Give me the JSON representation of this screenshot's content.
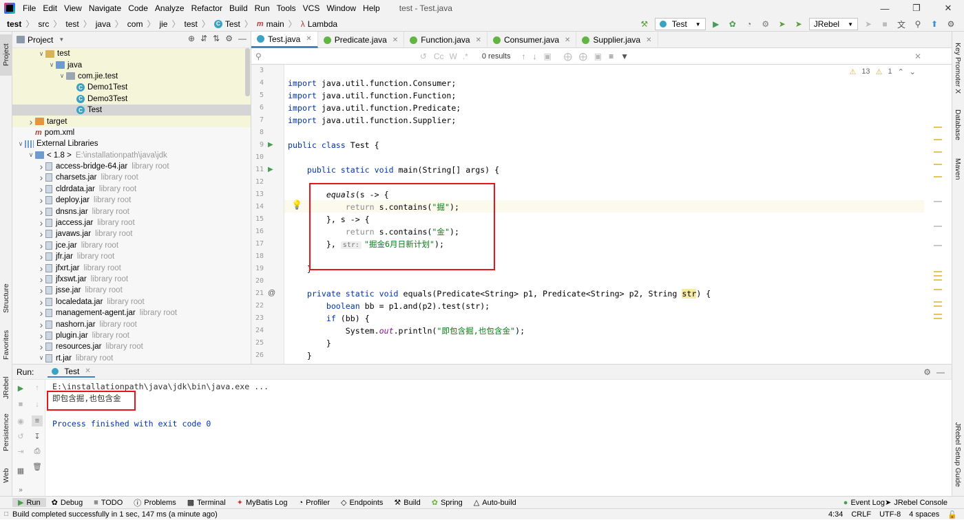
{
  "menubar": {
    "items": [
      "File",
      "Edit",
      "View",
      "Navigate",
      "Code",
      "Analyze",
      "Refactor",
      "Build",
      "Run",
      "Tools",
      "VCS",
      "Window",
      "Help"
    ],
    "window_title": "test - Test.java"
  },
  "breadcrumb": {
    "items": [
      "test",
      "src",
      "test",
      "java",
      "com",
      "jie",
      "test",
      "Test",
      "main",
      "Lambda"
    ]
  },
  "toolbar": {
    "run_config": "Test",
    "jrebel": "JRebel"
  },
  "project": {
    "title": "Project",
    "tree": [
      {
        "label": "test",
        "depth": 2,
        "type": "folder",
        "arrow": "open"
      },
      {
        "label": "java",
        "depth": 3,
        "type": "folder-blue",
        "arrow": "open"
      },
      {
        "label": "com.jie.test",
        "depth": 4,
        "type": "package",
        "arrow": "open"
      },
      {
        "label": "Demo1Test",
        "depth": 5,
        "type": "class"
      },
      {
        "label": "Demo3Test",
        "depth": 5,
        "type": "class"
      },
      {
        "label": "Test",
        "depth": 5,
        "type": "class",
        "selected": true
      },
      {
        "label": "target",
        "depth": 1,
        "type": "folder-orange",
        "arrow": "closed"
      },
      {
        "label": "pom.xml",
        "depth": 1,
        "type": "maven"
      },
      {
        "label": "External Libraries",
        "depth": 0,
        "type": "lib",
        "arrow": "open"
      },
      {
        "label": "< 1.8 >",
        "dim": "E:\\installationpath\\java\\jdk",
        "depth": 1,
        "type": "folder-blue",
        "arrow": "open"
      },
      {
        "label": "access-bridge-64.jar",
        "dim": "library root",
        "depth": 2,
        "type": "jar",
        "arrow": "closed"
      },
      {
        "label": "charsets.jar",
        "dim": "library root",
        "depth": 2,
        "type": "jar",
        "arrow": "closed"
      },
      {
        "label": "cldrdata.jar",
        "dim": "library root",
        "depth": 2,
        "type": "jar",
        "arrow": "closed"
      },
      {
        "label": "deploy.jar",
        "dim": "library root",
        "depth": 2,
        "type": "jar",
        "arrow": "closed"
      },
      {
        "label": "dnsns.jar",
        "dim": "library root",
        "depth": 2,
        "type": "jar",
        "arrow": "closed"
      },
      {
        "label": "jaccess.jar",
        "dim": "library root",
        "depth": 2,
        "type": "jar",
        "arrow": "closed"
      },
      {
        "label": "javaws.jar",
        "dim": "library root",
        "depth": 2,
        "type": "jar",
        "arrow": "closed"
      },
      {
        "label": "jce.jar",
        "dim": "library root",
        "depth": 2,
        "type": "jar",
        "arrow": "closed"
      },
      {
        "label": "jfr.jar",
        "dim": "library root",
        "depth": 2,
        "type": "jar",
        "arrow": "closed"
      },
      {
        "label": "jfxrt.jar",
        "dim": "library root",
        "depth": 2,
        "type": "jar",
        "arrow": "closed"
      },
      {
        "label": "jfxswt.jar",
        "dim": "library root",
        "depth": 2,
        "type": "jar",
        "arrow": "closed"
      },
      {
        "label": "jsse.jar",
        "dim": "library root",
        "depth": 2,
        "type": "jar",
        "arrow": "closed"
      },
      {
        "label": "localedata.jar",
        "dim": "library root",
        "depth": 2,
        "type": "jar",
        "arrow": "closed"
      },
      {
        "label": "management-agent.jar",
        "dim": "library root",
        "depth": 2,
        "type": "jar",
        "arrow": "closed"
      },
      {
        "label": "nashorn.jar",
        "dim": "library root",
        "depth": 2,
        "type": "jar",
        "arrow": "closed"
      },
      {
        "label": "plugin.jar",
        "dim": "library root",
        "depth": 2,
        "type": "jar",
        "arrow": "closed"
      },
      {
        "label": "resources.jar",
        "dim": "library root",
        "depth": 2,
        "type": "jar",
        "arrow": "closed"
      },
      {
        "label": "rt.jar",
        "dim": "library root",
        "depth": 2,
        "type": "jar",
        "arrow": "open"
      }
    ]
  },
  "tabs": [
    {
      "label": "Test.java",
      "active": true,
      "icon": "class"
    },
    {
      "label": "Predicate.java",
      "icon": "interface"
    },
    {
      "label": "Function.java",
      "icon": "interface"
    },
    {
      "label": "Consumer.java",
      "icon": "interface"
    },
    {
      "label": "Supplier.java",
      "icon": "interface"
    }
  ],
  "search": {
    "results": "0 results",
    "cc": "Cc",
    "w": "W"
  },
  "inspections": {
    "warnings": "13",
    "weak": "1"
  },
  "editor": {
    "lines": [
      "3",
      "4",
      "5",
      "6",
      "7",
      "8",
      "9",
      "10",
      "11",
      "12",
      "13",
      "14",
      "15",
      "16",
      "17",
      "18",
      "19",
      "20",
      "21",
      "22",
      "23",
      "24",
      "25",
      "26"
    ],
    "code": {
      "l4a": "import",
      "l4b": " java.util.function.Consumer;",
      "l5a": "import",
      "l5b": " java.util.function.Function;",
      "l6a": "import",
      "l6b": " java.util.function.Predicate;",
      "l7a": "import",
      "l7b": " java.util.function.Supplier;",
      "l9a": "public class",
      "l9b": " Test {",
      "l11a": "    public static void",
      "l11b": " main(String[] args) {",
      "l13a": "        equals",
      "l13b": "(s -> {",
      "l14a": "            return",
      "l14b": " s.contains(",
      "l14c": "\"掘\"",
      "l14d": ");",
      "l15a": "        }, s -> {",
      "l16a": "            return",
      "l16b": " s.contains(",
      "l16c": "\"金\"",
      "l16d": ");",
      "l17a": "        },",
      "l17hint": "str:",
      "l17c": "\"掘金6月日新计划\"",
      "l17d": ");",
      "l19a": "    }",
      "l21a": "    private static void",
      "l21b": " equals(Predicate<String> p1, Predicate<String> p2, String ",
      "l21c": "str",
      "l21d": ") {",
      "l22a": "        boolean",
      "l22b": " bb = p1.and(p2).test(str);",
      "l23a": "        if",
      "l23b": " (bb) {",
      "l24a": "            System.",
      "l24b": "out",
      "l24c": ".println(",
      "l24d": "\"即包含掘,也包含金\"",
      "l24e": ");",
      "l25a": "        }",
      "l26a": "    }"
    }
  },
  "run": {
    "label": "Run:",
    "tab": "Test",
    "cmd": "E:\\installationpath\\java\\jdk\\bin\\java.exe ...",
    "output": "即包含掘,也包含金",
    "finish": "Process finished with exit code 0"
  },
  "left_tool_tabs": [
    "Project",
    "Structure",
    "Favorites",
    "JRebel",
    "Persistence",
    "Web"
  ],
  "right_tool_tabs": [
    "Key Promoter X",
    "Database",
    "Maven",
    "JRebel Setup Guide"
  ],
  "bottom_tabs": [
    "Run",
    "Debug",
    "TODO",
    "Problems",
    "Terminal",
    "MyBatis Log",
    "Profiler",
    "Endpoints",
    "Build",
    "Spring",
    "Auto-build"
  ],
  "bottom_right": [
    "Event Log",
    "JRebel Console"
  ],
  "status": {
    "message": "Build completed successfully in 1 sec, 147 ms (a minute ago)",
    "position": "4:34",
    "line_sep": "CRLF",
    "encoding": "UTF-8",
    "indent": "4 spaces"
  }
}
